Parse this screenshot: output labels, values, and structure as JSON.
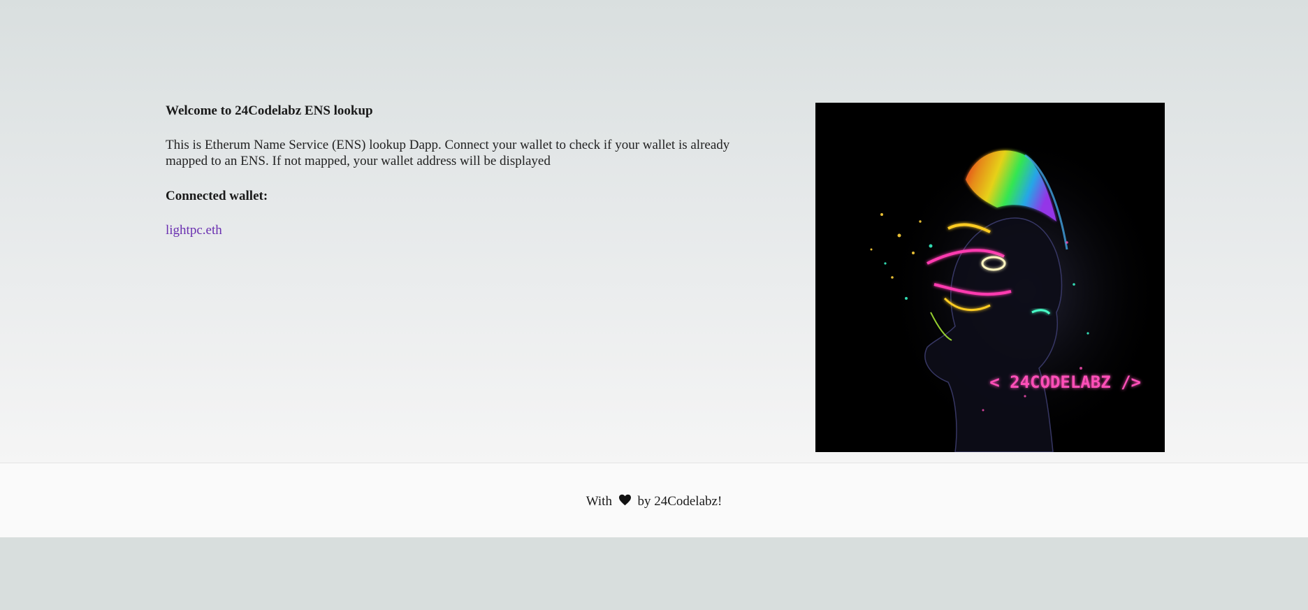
{
  "main": {
    "welcome_title": "Welcome to 24Codelabz ENS lookup",
    "description": "This is Etherum Name Service (ENS) lookup Dapp. Connect your wallet to check if your wallet is already mapped to an ENS. If not mapped, your wallet address will be displayed",
    "wallet_heading": "Connected wallet:",
    "wallet_value": "lightpc.eth"
  },
  "art": {
    "logo_text": "< 24CODELABZ />",
    "icon": "neon-head-artwork"
  },
  "footer": {
    "prefix": "With",
    "icon": "heart-icon",
    "suffix": "by 24Codelabz!"
  },
  "colors": {
    "wallet_link": "#6a2fb0",
    "logo_pink": "#ff4fb8",
    "background": "#d8dedd"
  }
}
